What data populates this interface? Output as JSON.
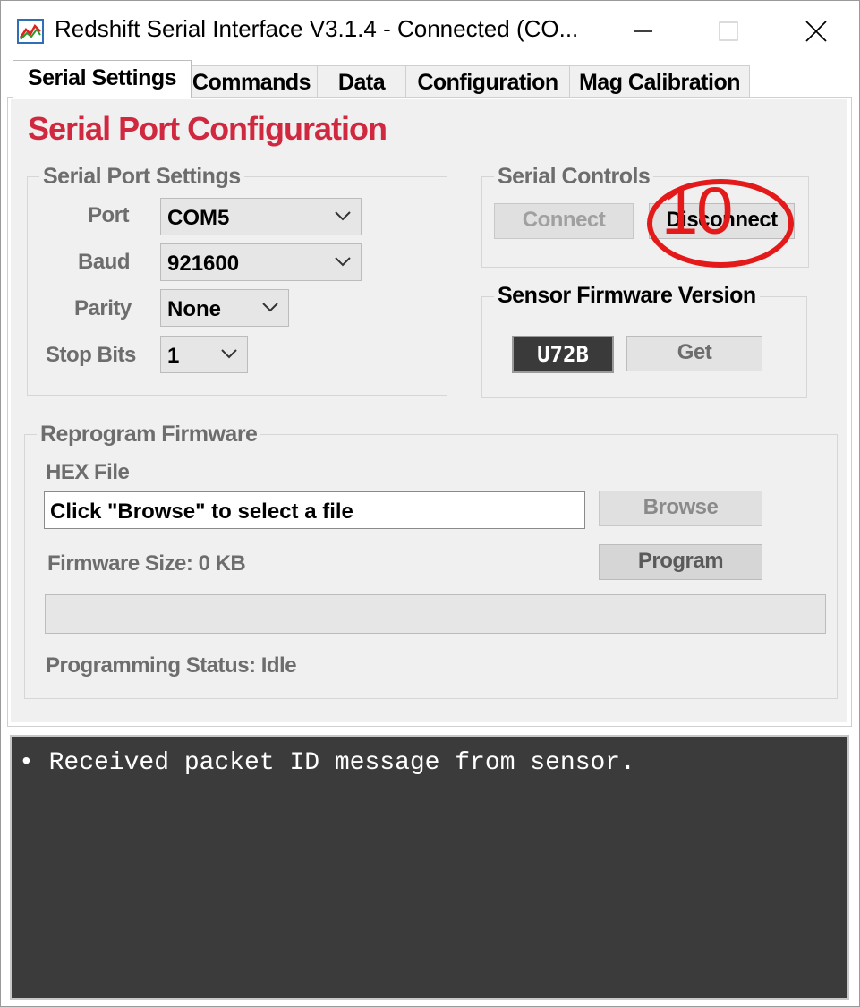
{
  "window": {
    "title": "Redshift Serial Interface V3.1.4 - Connected (CO...",
    "app_icon": "chart-icon"
  },
  "tabs": [
    {
      "label": "Serial Settings",
      "active": true
    },
    {
      "label": "Commands",
      "active": false
    },
    {
      "label": "Data",
      "active": false
    },
    {
      "label": "Configuration",
      "active": false
    },
    {
      "label": "Mag Calibration",
      "active": false
    }
  ],
  "page": {
    "title": "Serial Port Configuration",
    "title_color": "#d0283f"
  },
  "serial_port_settings": {
    "legend": "Serial Port Settings",
    "port_label": "Port",
    "port_value": "COM5",
    "baud_label": "Baud",
    "baud_value": "921600",
    "parity_label": "Parity",
    "parity_value": "None",
    "stopbits_label": "Stop Bits",
    "stopbits_value": "1"
  },
  "serial_controls": {
    "legend": "Serial Controls",
    "connect_label": "Connect",
    "disconnect_label": "Disconnect"
  },
  "firmware_version": {
    "legend": "Sensor Firmware Version",
    "value": "U72B",
    "get_label": "Get"
  },
  "reprogram": {
    "legend": "Reprogram Firmware",
    "hex_label": "HEX File",
    "hex_value": "Click \"Browse\" to select a file",
    "browse_label": "Browse",
    "size_text": "Firmware Size: 0 KB",
    "program_label": "Program",
    "progress": 0,
    "status_text": "Programming Status: Idle"
  },
  "annotation": {
    "number": "10",
    "color": "#e41a1a"
  },
  "console": {
    "lines": [
      "• Received packet ID message from sensor."
    ]
  }
}
